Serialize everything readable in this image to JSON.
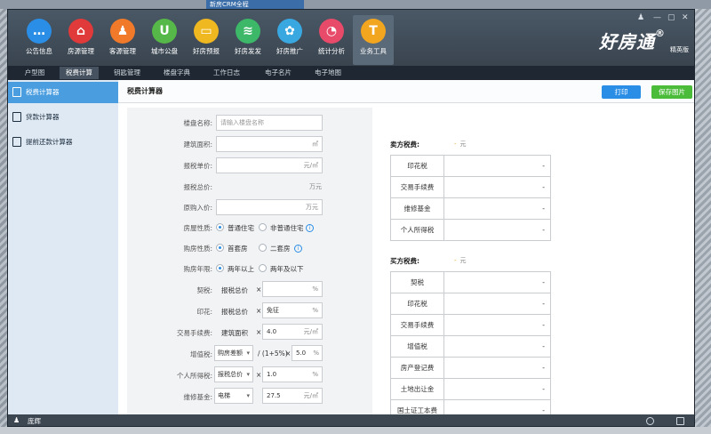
{
  "desktop": {
    "tabs": [
      "新房CRM全程",
      "",
      ""
    ]
  },
  "header": {
    "nav": [
      {
        "label": "公告信息",
        "icon": "chat-bubble-icon",
        "color": "#2a8ee6",
        "glyph": "…"
      },
      {
        "label": "房源管理",
        "icon": "house-icon",
        "color": "#e03a3a",
        "glyph": "⌂"
      },
      {
        "label": "客源管理",
        "icon": "person-icon",
        "color": "#f07a2a",
        "glyph": "♟"
      },
      {
        "label": "城市公盘",
        "icon": "u-icon",
        "color": "#56b848",
        "glyph": "U"
      },
      {
        "label": "好房预报",
        "icon": "monitor-icon",
        "color": "#f0b820",
        "glyph": "▭"
      },
      {
        "label": "好房发发",
        "icon": "stack-icon",
        "color": "#3cb868",
        "glyph": "≋"
      },
      {
        "label": "好房推广",
        "icon": "share-icon",
        "color": "#39a8e0",
        "glyph": "✿"
      },
      {
        "label": "统计分析",
        "icon": "pie-chart-icon",
        "color": "#e84a6a",
        "glyph": "◔"
      },
      {
        "label": "业务工具",
        "icon": "hammer-icon",
        "color": "#f2a51e",
        "glyph": "T"
      }
    ],
    "brand": "好房通",
    "brand_mark": "®",
    "brand_sub": "精英版"
  },
  "subtabs": [
    "户型图",
    "税费计算",
    "钥匙管理",
    "楼盘字典",
    "工作日志",
    "电子名片",
    "电子地图"
  ],
  "left_menu": [
    "税费计算器",
    "贷款计算器",
    "提前还款计算器"
  ],
  "main": {
    "title": "税费计算器",
    "print_label": "打印",
    "save_label": "保存图片"
  },
  "form": {
    "project_label": "楼盘名称:",
    "project_placeholder": "请输入楼盘名称",
    "area_label": "建筑面积:",
    "area_unit": "㎡",
    "unit_price_label": "报税单价:",
    "unit_price_unit": "元/㎡",
    "total_label": "报税总价:",
    "total_unit": "万元",
    "original_label": "原购入价:",
    "original_unit": "万元",
    "property_label": "房屋性质:",
    "property_opt1": "普通住宅",
    "property_opt2": "非普通住宅",
    "buyer_label": "购房性质:",
    "buyer_opt1": "首套房",
    "buyer_opt2": "二套房",
    "years_label": "购房年限:",
    "years_opt1": "两年以上",
    "years_opt2": "两年及以下",
    "deed_label": "契税:",
    "deed_base": "报税总价",
    "deed_unit": "%",
    "stamp_label": "印花:",
    "stamp_base": "报税总价",
    "stamp_value": "免征",
    "stamp_unit": "%",
    "trade_label": "交易手续费:",
    "trade_base": "建筑面积",
    "trade_value": "4.0",
    "trade_unit": "元/㎡",
    "vat_label": "增值税:",
    "vat_select": "购房差额",
    "vat_formula": "/ (1+5%)",
    "vat_value": "5.0",
    "vat_unit": "%",
    "income_label": "个人所得税:",
    "income_select": "报税总价",
    "income_value": "1.0",
    "income_unit": "%",
    "maint_label": "维修基金:",
    "maint_select": "电梯",
    "maint_value": "27.5",
    "maint_unit": "元/㎡",
    "times": "×"
  },
  "seller": {
    "title": "卖方税费:",
    "total": "-",
    "total_unit": "元",
    "rows": [
      {
        "k": "印花税",
        "v": "-"
      },
      {
        "k": "交易手续费",
        "v": "-"
      },
      {
        "k": "维修基金",
        "v": "-"
      },
      {
        "k": "个人所得税",
        "v": "-"
      }
    ]
  },
  "buyer": {
    "title": "买方税费:",
    "total": "-",
    "total_unit": "元",
    "rows": [
      {
        "k": "契税",
        "v": "-"
      },
      {
        "k": "印花税",
        "v": "-"
      },
      {
        "k": "交易手续费",
        "v": "-"
      },
      {
        "k": "增值税",
        "v": "-"
      },
      {
        "k": "房产登记费",
        "v": "-"
      },
      {
        "k": "土地出让金",
        "v": "-"
      },
      {
        "k": "国土证工本费",
        "v": "-"
      }
    ]
  },
  "status": {
    "user": "庞辉"
  }
}
